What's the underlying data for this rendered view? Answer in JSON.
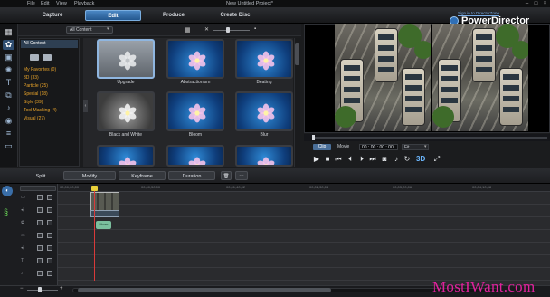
{
  "titlebar": {
    "menu": [
      "File",
      "Edit",
      "View",
      "Playback"
    ],
    "title": "New Untitled Project*"
  },
  "modes": [
    "Capture",
    "Edit",
    "Produce",
    "Create Disc"
  ],
  "active_mode": "Edit",
  "signin": "Sign in to DirectorZone",
  "brand": "PowerDirector",
  "library": {
    "filter": "All Content",
    "categories_header": "All Content",
    "categories": [
      "My Favorites (0)",
      "3D (33)",
      "Particle (25)",
      "Special (18)",
      "Style (39)",
      "Tool Masking (4)",
      "Visual (27)"
    ],
    "tiles": [
      {
        "label": "Upgrade",
        "style": "upgrade"
      },
      {
        "label": "Abstractionism",
        "style": "blue"
      },
      {
        "label": "Beating",
        "style": "blue"
      },
      {
        "label": "Black and White",
        "style": "bw"
      },
      {
        "label": "Bloom",
        "style": "blue"
      },
      {
        "label": "Blur",
        "style": "blue"
      },
      {
        "label": "",
        "style": "blue"
      },
      {
        "label": "",
        "style": "blue"
      },
      {
        "label": "",
        "style": "blue"
      }
    ]
  },
  "preview": {
    "mode_clip": "Clip",
    "mode_movie": "Movie",
    "timecode": "00 : 00 : 00 : 00",
    "fit": "Fit",
    "three_d": "3D",
    "controls": [
      "play-icon",
      "stop-icon",
      "prev-icon",
      "rewind-icon",
      "next-frame-icon",
      "forward-icon",
      "snapshot-icon",
      "volume-icon",
      "loop-icon",
      "fullscreen-icon"
    ]
  },
  "editbar": {
    "split": "Split",
    "modify": "Modify",
    "keyframe": "Keyframe",
    "duration": "Duration"
  },
  "ruler": [
    "00;00;00;00",
    "00;00;50;00",
    "00;01;40;02",
    "00;02;30;04",
    "00;03;20;06",
    "00;04;10;08"
  ],
  "clips": {
    "video": "",
    "fx": "Bloom"
  },
  "watermark": "MostIWant.com",
  "colors": {
    "accent": "#4b87c4",
    "category_text": "#e8a32a",
    "playhead": "#d93a3a",
    "watermark": "#e0219c"
  }
}
